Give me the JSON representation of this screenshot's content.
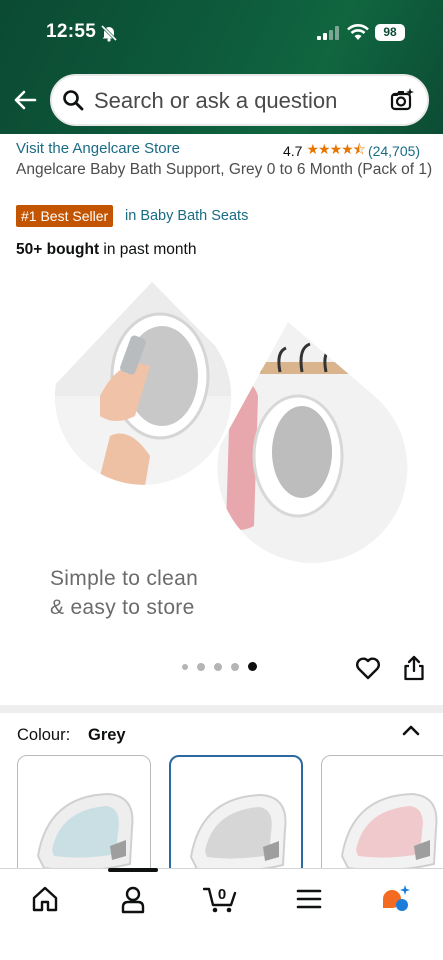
{
  "status_bar": {
    "time": "12:55",
    "battery": "98"
  },
  "search": {
    "placeholder": "Search or ask a question"
  },
  "product": {
    "store_link": "Visit the Angelcare Store",
    "rating_value": "4.7",
    "rating_stars": 4.7,
    "rating_count": "(24,705)",
    "title": "Angelcare Baby Bath Support, Grey 0 to 6 Month (Pack of 1)",
    "badge": "#1 Best Seller",
    "badge_category": "in Baby Bath Seats",
    "bought_bold": "50+ bought",
    "bought_rest": "in past month"
  },
  "image_caption": {
    "line1": "Simple to clean",
    "line2": "& easy to store"
  },
  "carousel": {
    "count": 5,
    "active_index": 4
  },
  "colour": {
    "label": "Colour:",
    "value": "Grey",
    "swatches": [
      {
        "name": "light-blue",
        "tint": "#c9dfe3",
        "selected": false
      },
      {
        "name": "grey",
        "tint": "#d6d6d6",
        "selected": true
      },
      {
        "name": "pink",
        "tint": "#efc9cc",
        "selected": false
      }
    ]
  },
  "tabbar": {
    "items": [
      "home",
      "account",
      "cart",
      "menu",
      "rufus"
    ],
    "cart_count": "0",
    "active": "account"
  },
  "colors": {
    "header": "#0d5a3c",
    "link": "#1a6b84",
    "badge": "#c45500",
    "stars": "#e77600",
    "selected_swatch": "#2a6aa0"
  }
}
